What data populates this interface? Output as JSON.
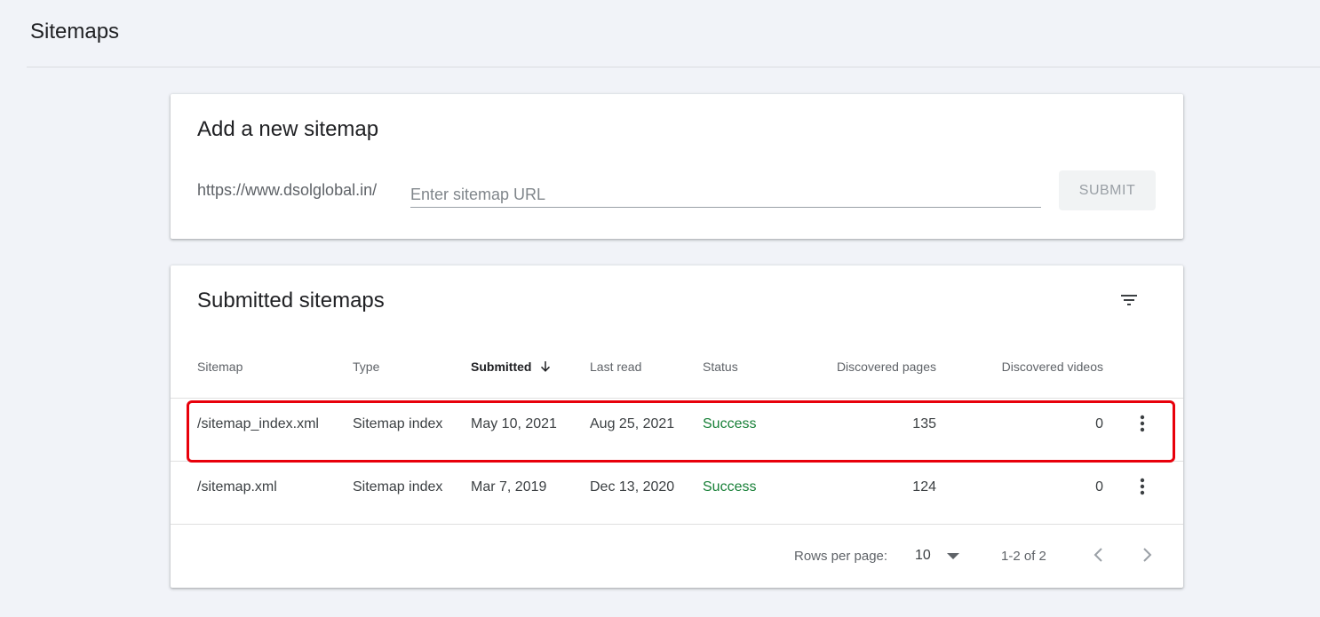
{
  "page": {
    "title": "Sitemaps"
  },
  "add_sitemap": {
    "title": "Add a new sitemap",
    "url_prefix": "https://www.dsolglobal.in/",
    "input_value": "",
    "input_placeholder": "Enter sitemap URL",
    "submit_label": "SUBMIT"
  },
  "submitted": {
    "title": "Submitted sitemaps",
    "columns": {
      "sitemap": "Sitemap",
      "type": "Type",
      "submitted": "Submitted",
      "last_read": "Last read",
      "status": "Status",
      "discovered_pages": "Discovered pages",
      "discovered_videos": "Discovered videos"
    },
    "sort": {
      "column": "submitted",
      "direction": "descending"
    },
    "rows": [
      {
        "sitemap": "/sitemap_index.xml",
        "type": "Sitemap index",
        "submitted": "May 10, 2021",
        "last_read": "Aug 25, 2021",
        "status": "Success",
        "discovered_pages": "135",
        "discovered_videos": "0",
        "highlighted": true
      },
      {
        "sitemap": "/sitemap.xml",
        "type": "Sitemap index",
        "submitted": "Mar 7, 2019",
        "last_read": "Dec 13, 2020",
        "status": "Success",
        "discovered_pages": "124",
        "discovered_videos": "0",
        "highlighted": false
      }
    ],
    "pagination": {
      "rows_per_page_label": "Rows per page:",
      "rows_per_page_value": "10",
      "range_label": "1-2 of 2"
    }
  },
  "icons": {
    "filter": "filter-icon",
    "sort": "arrow-down-icon",
    "more": "more-vert-icon",
    "dropdown": "caret-down-icon",
    "prev": "chevron-left-icon",
    "next": "chevron-right-icon"
  },
  "colors": {
    "background": "#f1f3f8",
    "card": "#ffffff",
    "success": "#188038",
    "highlight": "#e8000b"
  }
}
